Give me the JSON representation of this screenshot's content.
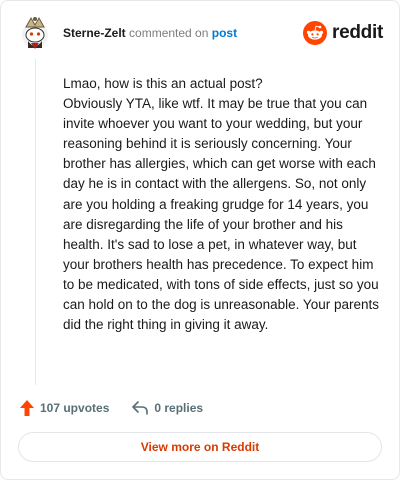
{
  "header": {
    "username": "Sterne-Zelt",
    "action_text": "commented on",
    "post_link_text": "post",
    "logo_text": "reddit"
  },
  "comment": {
    "paragraphs": [
      "Lmao, how is this an actual post?",
      "Obviously YTA, like wtf. It may be true that you can invite whoever you want to your wedding, but your reasoning behind it is seriously concerning. Your brother has allergies, which can get worse with each day he is in contact with the allergens. So, not only are you holding a freaking grudge for 14 years, you are disregarding the life of your brother and his health. It's sad to lose a pet, in whatever way, but your brothers health has precedence. To expect him to be medicated, with tons of side effects, just so you can hold on to the dog is unreasonable. Your parents did the right thing in giving it away."
    ]
  },
  "actions": {
    "upvotes_label": "107 upvotes",
    "replies_label": "0 replies"
  },
  "footer": {
    "view_more_label": "View more on Reddit"
  },
  "colors": {
    "reddit_orange": "#ff4500",
    "link_blue": "#0079d3",
    "button_text": "#d93a00"
  },
  "icons": {
    "avatar": "snoo-avatar",
    "logo": "reddit-snoo-icon",
    "upvote": "upvote-arrow-icon",
    "reply": "reply-arrow-icon"
  }
}
